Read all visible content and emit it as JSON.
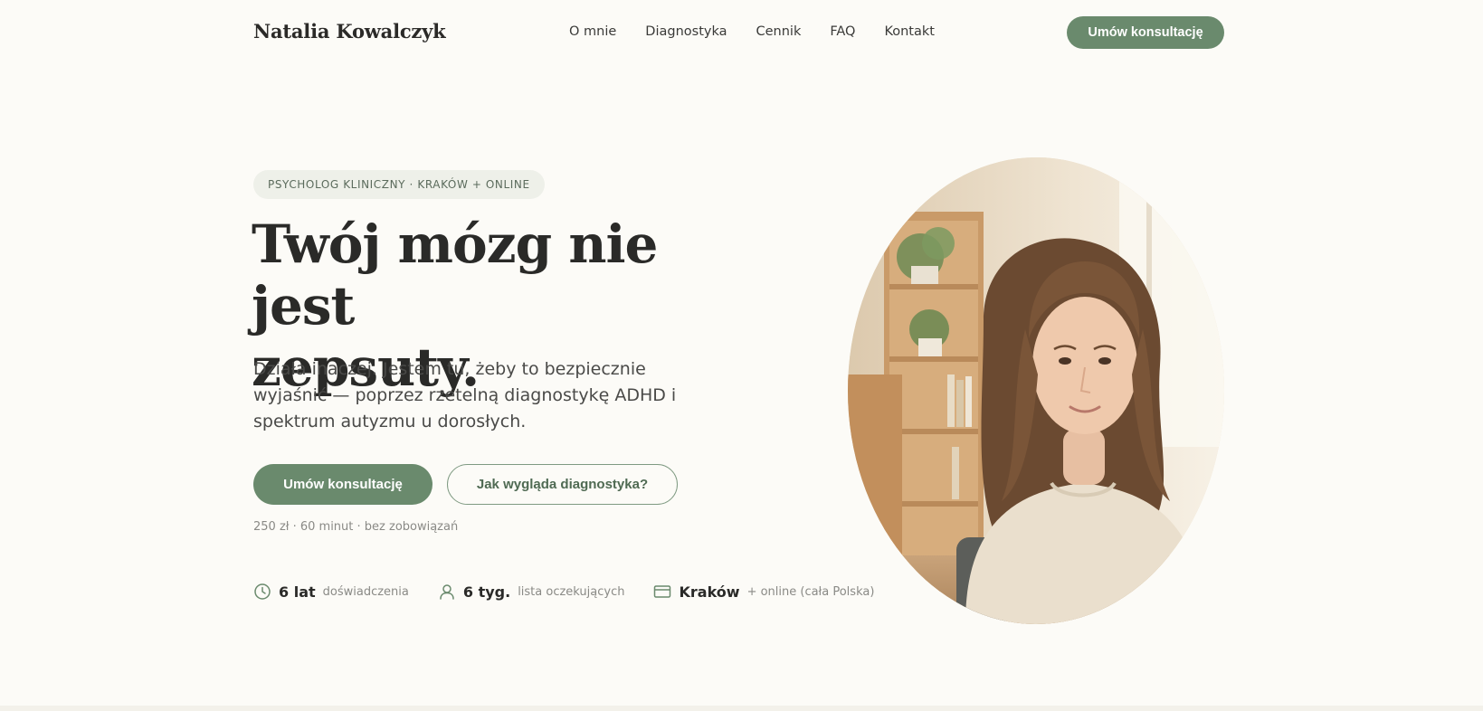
{
  "nav": {
    "brand": "Natalia Kowalczyk",
    "links": [
      {
        "label": "O mnie"
      },
      {
        "label": "Diagnostyka"
      },
      {
        "label": "Cennik"
      },
      {
        "label": "FAQ"
      },
      {
        "label": "Kontakt"
      }
    ],
    "cta_label": "Umów konsultację"
  },
  "hero": {
    "eyebrow": "PSYCHOLOG KLINICZNY · KRAKÓW + ONLINE",
    "headline_line1": "Twój mózg nie jest",
    "headline_line2": "zepsuty.",
    "subtext": "Działa inaczej. Jestem tu, żeby to bezpiecznie wyjaśnić — poprzez rzetelną diagnostykę ADHD i spektrum autyzmu u dorosłych.",
    "primary_button": "Umów konsultację",
    "secondary_button": "Jak wygląda diagnostyka?",
    "price_note": "250 zł · 60 minut · bez zobowiązań"
  },
  "stats": [
    {
      "icon": "clock-icon",
      "value": "6 lat",
      "label": "doświadczenia"
    },
    {
      "icon": "person-icon",
      "value": "6 tyg.",
      "label": "lista oczekujących"
    },
    {
      "icon": "card-icon",
      "value": "Kraków",
      "label": "+ online (cała Polska)"
    }
  ],
  "colors": {
    "background": "#fcfbf7",
    "accent": "#6a8a6d",
    "text": "#2a2a28",
    "muted": "#8a8a86"
  }
}
